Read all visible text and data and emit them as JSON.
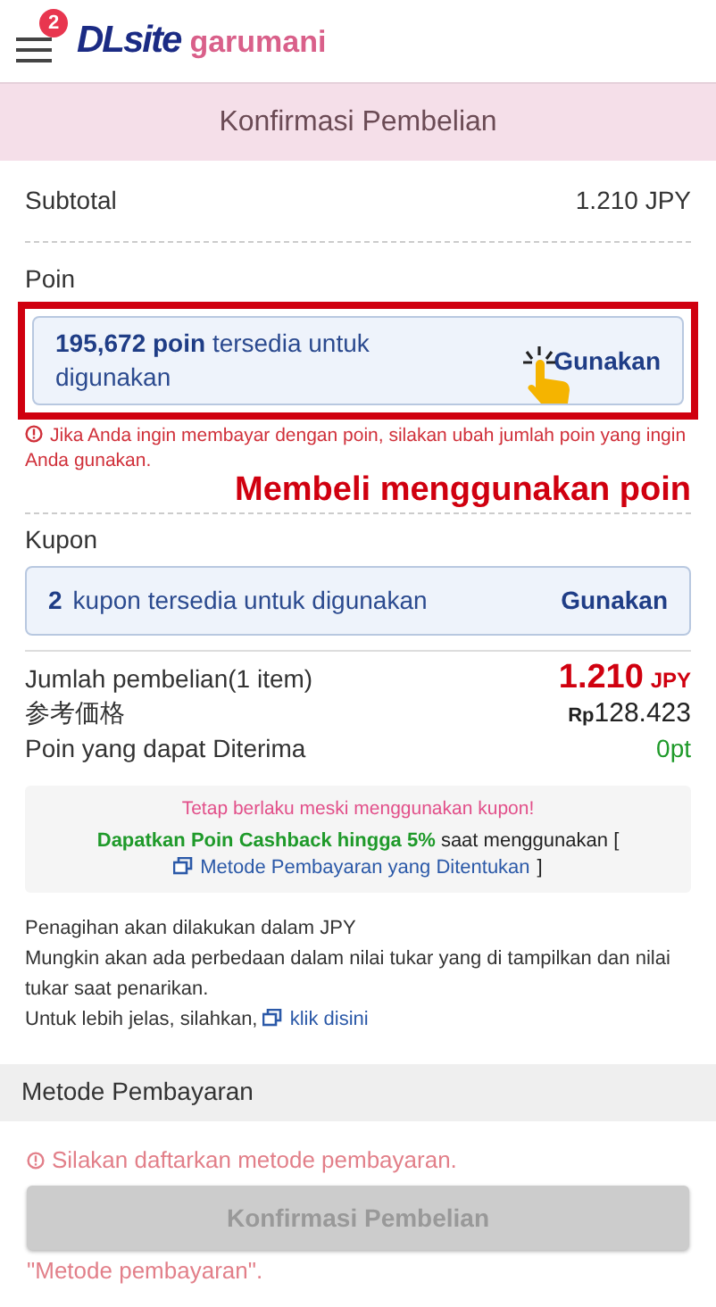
{
  "header": {
    "menu_badge": "2",
    "logo_main": "DLsite",
    "logo_sub": "garumani"
  },
  "page_title": "Konfirmasi Pembelian",
  "subtotal": {
    "label": "Subtotal",
    "value": "1.210 JPY"
  },
  "points": {
    "label": "Poin",
    "amount": "195,672 poin",
    "text": "tersedia untuk digunakan",
    "action": "Gunakan",
    "highlighted": true,
    "warning": "Jika Anda ingin membayar dengan poin, silakan ubah jumlah poin yang ingin Anda gunakan.",
    "annotation": "Membeli menggunakan poin"
  },
  "coupon": {
    "label": "Kupon",
    "count": "2",
    "text": "kupon tersedia untuk digunakan",
    "action": "Gunakan"
  },
  "totals": [
    {
      "kind": "price",
      "label": "Jumlah pembelian(1 item)",
      "value": "1.210",
      "unit": "JPY"
    },
    {
      "kind": "reference",
      "label": "参考価格",
      "unit": "Rp",
      "value": "128.423"
    },
    {
      "kind": "points",
      "label": "Poin yang dapat Diterima",
      "value": "0pt"
    }
  ],
  "cashback": {
    "note": "Tetap berlaku meski menggunakan kupon!",
    "highlight": "Dapatkan Poin Cashback hingga 5%",
    "text": "saat menggunakan [",
    "link": "Metode Pembayaran yang Ditentukan",
    "close": "]"
  },
  "info": {
    "lines": [
      "Penagihan akan dilakukan dalam JPY",
      "Mungkin akan ada perbedaan dalam nilai tukar yang di tampilkan dan nilai tukar saat penarikan."
    ],
    "more_text": "Untuk lebih jelas, silahkan,",
    "more_link": "klik disini"
  },
  "payment": {
    "title": "Metode Pembayaran",
    "faded_warning": "Silakan daftarkan metode pembayaran.",
    "faded_note": "\"Metode pembayaran\"."
  },
  "confirm_button": {
    "label": "Konfirmasi Pembelian",
    "disabled": true
  }
}
